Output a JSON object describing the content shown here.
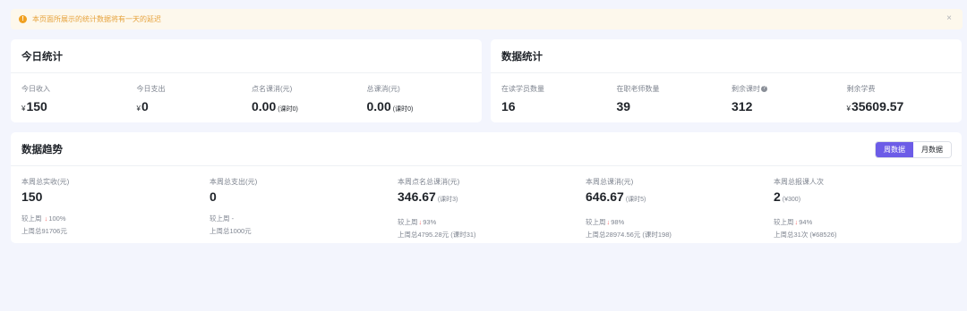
{
  "notice": {
    "text": "本页面所展示的统计数据将有一天的延迟",
    "close": "×"
  },
  "today": {
    "title": "今日统计",
    "items": [
      {
        "label": "今日收入",
        "currency": "¥",
        "value": "150",
        "unit": ""
      },
      {
        "label": "今日支出",
        "currency": "¥",
        "value": "0",
        "unit": ""
      },
      {
        "label": "点名课消(元)",
        "currency": "",
        "value": "0.00",
        "unit": "(课时0)"
      },
      {
        "label": "总课消(元)",
        "currency": "",
        "value": "0.00",
        "unit": "(课时0)"
      }
    ]
  },
  "data_stats": {
    "title": "数据统计",
    "items": [
      {
        "label": "在读学员数量",
        "currency": "",
        "value": "16"
      },
      {
        "label": "在职老师数量",
        "currency": "",
        "value": "39"
      },
      {
        "label": "剩余课时",
        "currency": "",
        "value": "312",
        "help": "?"
      },
      {
        "label": "剩余学费",
        "currency": "¥",
        "value": "35609.57"
      }
    ]
  },
  "trend": {
    "title": "数据趋势",
    "tabs": [
      {
        "label": "周数据"
      },
      {
        "label": "月数据"
      }
    ],
    "arrow": "↓",
    "items": [
      {
        "label": "本周总实收(元)",
        "value": "150",
        "unit": "",
        "cmp_label": "较上周",
        "cmp_value": "100%",
        "has_arrow": true,
        "last": "上周总91706元"
      },
      {
        "label": "本周总支出(元)",
        "value": "0",
        "unit": "",
        "cmp_label": "较上周",
        "cmp_value": "-",
        "has_arrow": false,
        "last": "上周总1000元"
      },
      {
        "label": "本周点名总课消(元)",
        "value": "346.67",
        "unit": "(课时3)",
        "cmp_label": "较上周",
        "cmp_value": "93%",
        "has_arrow": true,
        "last": "上周总4795.28元 (课时31)"
      },
      {
        "label": "本周总课消(元)",
        "value": "646.67",
        "unit": "(课时5)",
        "cmp_label": "较上周",
        "cmp_value": "98%",
        "has_arrow": true,
        "last": "上周总28974.56元 (课时198)"
      },
      {
        "label": "本周总报课人次",
        "value": "2",
        "unit": "(¥300)",
        "cmp_label": "较上周",
        "cmp_value": "94%",
        "has_arrow": true,
        "last": "上周总31次 (¥68526)"
      }
    ]
  }
}
